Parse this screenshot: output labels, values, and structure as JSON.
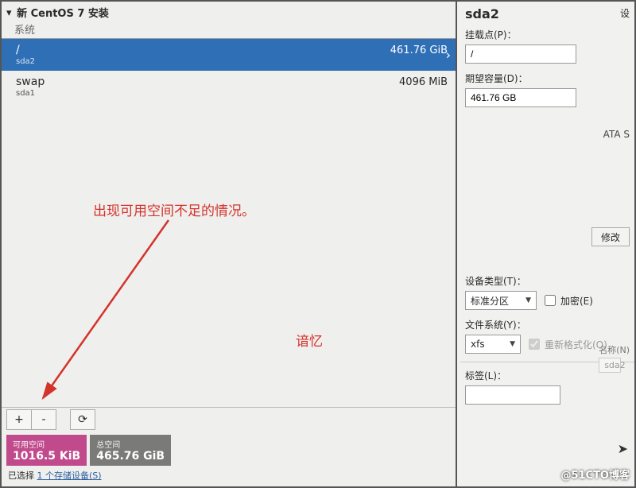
{
  "header": {
    "title": "新 CentOS 7 安装",
    "subtitle": "系统"
  },
  "mounts": [
    {
      "name": "/",
      "device": "sda2",
      "size": "461.76 GiB",
      "selected": true
    },
    {
      "name": "swap",
      "device": "sda1",
      "size": "4096 MiB",
      "selected": false
    }
  ],
  "annotation": {
    "warn": "出现可用空间不足的情况。",
    "mid": "谙忆"
  },
  "toolbar": {
    "add": "+",
    "remove": "-",
    "refresh": "⟳"
  },
  "space": {
    "available_label": "可用空间",
    "available_value": "1016.5 KiB",
    "total_label": "总空间",
    "total_value": "465.76 GiB"
  },
  "footer": {
    "text_prefix": "已选择 ",
    "link": "1 个存储设备(S)"
  },
  "right": {
    "title": "sda2",
    "mountpoint_label": "挂载点(P)：",
    "mountpoint_value": "/",
    "capacity_label": "期望容量(D)：",
    "capacity_value": "461.76 GB",
    "device_extra": "ATA S",
    "modify": "修改",
    "device_type_label": "设备类型(T)：",
    "device_type_value": "标准分区",
    "encrypt_label": "加密(E)",
    "fs_label": "文件系统(Y)：",
    "fs_value": "xfs",
    "reformat_label": "重新格式化(O)",
    "tag_label": "标签(L)：",
    "tag_value": "",
    "name_label": "名称(N)",
    "name_value": "sda2",
    "settings_abbrev": "设"
  },
  "watermark": "@51CTO博客"
}
